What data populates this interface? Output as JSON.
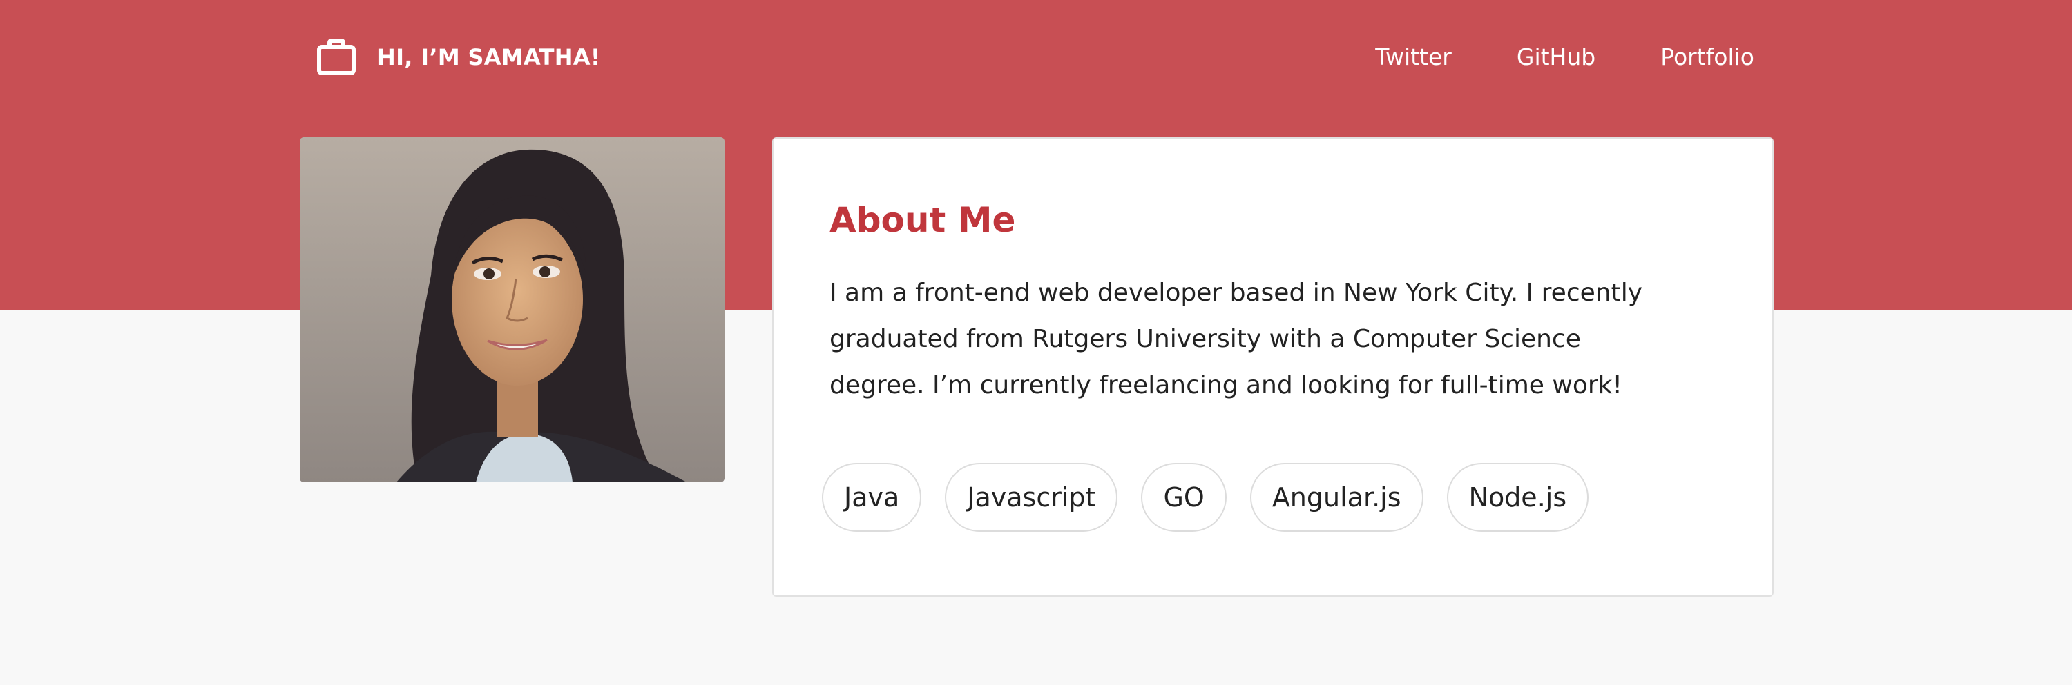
{
  "header": {
    "title": "HI, I’M SAMATHA!",
    "brand_icon": "briefcase-icon",
    "nav": [
      {
        "label": "Twitter"
      },
      {
        "label": "GitHub"
      },
      {
        "label": "Portfolio"
      }
    ]
  },
  "profile": {
    "photo_icon": "profile-photo"
  },
  "about": {
    "title": "About Me",
    "lines": [
      "I am a front-end web developer based in New York City.  I recently",
      "graduated from Rutgers University with a Computer Science",
      "degree.  I’m currently freelancing and looking for full-time work!"
    ],
    "skills": [
      "Java",
      "Javascript",
      "GO",
      "Angular.js",
      "Node.js"
    ]
  },
  "colors": {
    "accent": "#c84f54",
    "title": "#c0363c",
    "background": "#f8f8f8",
    "card": "#ffffff"
  }
}
